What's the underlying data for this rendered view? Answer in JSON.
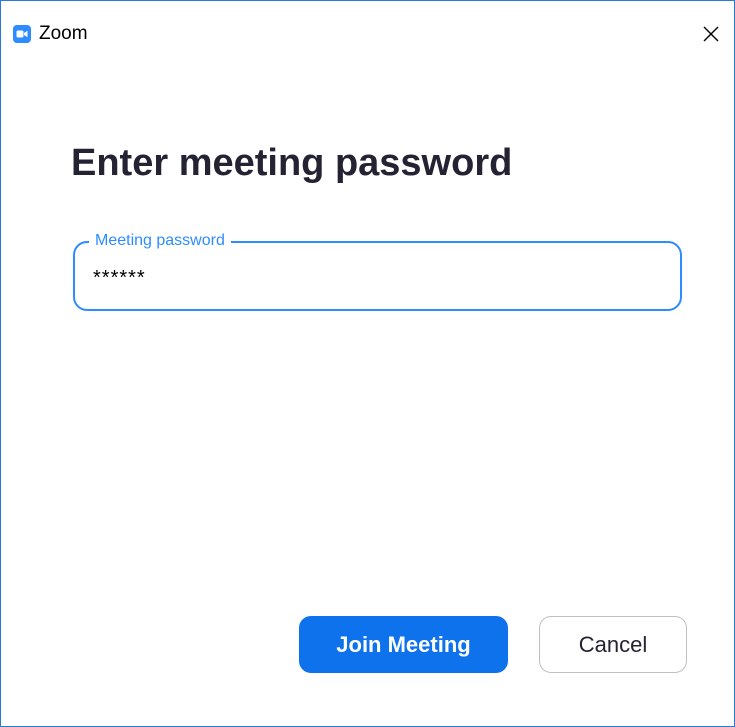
{
  "window": {
    "title": "Zoom",
    "app_icon": "zoom-camera-icon",
    "close_icon": "close-icon"
  },
  "dialog": {
    "heading": "Enter meeting password",
    "password_field": {
      "label": "Meeting password",
      "value": "******"
    },
    "join_button": "Join Meeting",
    "cancel_button": "Cancel"
  },
  "colors": {
    "accent": "#2d8cff",
    "primary_button": "#0e72ed",
    "window_border": "#2b79d6",
    "heading_text": "#232333"
  }
}
